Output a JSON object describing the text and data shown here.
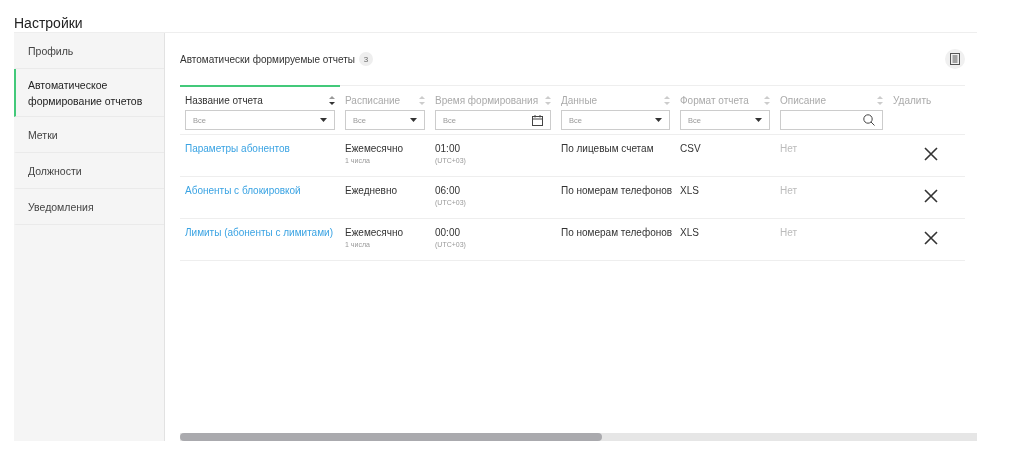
{
  "page_title": "Настройки",
  "sidebar": {
    "items": [
      {
        "label": "Профиль",
        "selected": false
      },
      {
        "label": "Автоматическое формирование отчетов",
        "selected": true
      },
      {
        "label": "Метки",
        "selected": false
      },
      {
        "label": "Должности",
        "selected": false
      },
      {
        "label": "Уведомления",
        "selected": false
      }
    ]
  },
  "section": {
    "title": "Автоматически формируемые отчеты",
    "count": "3"
  },
  "table": {
    "columns": [
      {
        "label": "Название отчета",
        "sortable": true,
        "active": true,
        "filter": {
          "kind": "dropdown",
          "value": "Все"
        }
      },
      {
        "label": "Расписание",
        "sortable": true,
        "active": false,
        "filter": {
          "kind": "dropdown",
          "value": "Все"
        }
      },
      {
        "label": "Время формирования",
        "sortable": true,
        "active": false,
        "filter": {
          "kind": "date",
          "value": "Все"
        }
      },
      {
        "label": "Данные",
        "sortable": true,
        "active": false,
        "filter": {
          "kind": "dropdown",
          "value": "Все"
        }
      },
      {
        "label": "Формат отчета",
        "sortable": true,
        "active": false,
        "filter": {
          "kind": "dropdown",
          "value": "Все"
        }
      },
      {
        "label": "Описание",
        "sortable": true,
        "active": false,
        "filter": {
          "kind": "search"
        }
      },
      {
        "label": "Удалить",
        "sortable": false,
        "active": false
      }
    ],
    "rows": [
      {
        "name": "Параметры абонентов",
        "schedule": "Ежемесячно",
        "schedule_note": "1 числа",
        "time": "01:00",
        "timezone": "(UTC+03)",
        "data": "По лицевым счетам",
        "format": "CSV",
        "description": "Нет"
      },
      {
        "name": "Абоненты с блокировкой",
        "schedule": "Ежедневно",
        "time": "06:00",
        "timezone": "(UTC+03)",
        "data": "По номерам телефонов",
        "format": "XLS",
        "description": "Нет"
      },
      {
        "name": "Лимиты (абоненты с лимитами)",
        "schedule": "Ежемесячно",
        "schedule_note": "1 числа",
        "time": "00:00",
        "timezone": "(UTC+03)",
        "data": "По номерам телефонов",
        "format": "XLS",
        "description": "Нет"
      }
    ]
  }
}
